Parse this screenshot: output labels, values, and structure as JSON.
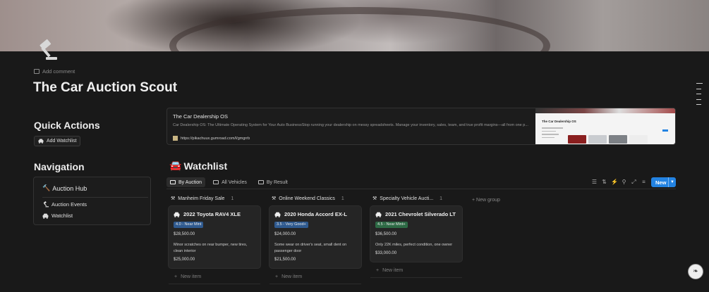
{
  "page": {
    "title": "The Car Auction Scout",
    "add_comment": "Add comment",
    "icon": "gavel-icon"
  },
  "quick_actions": {
    "heading": "Quick Actions",
    "add_watchlist": "Add Watchlist"
  },
  "navigation": {
    "heading": "Navigation",
    "hub_emoji": "🔨",
    "hub": "Auction Hub",
    "items": [
      {
        "label": "Auction Events",
        "icon": "gavel-icon"
      },
      {
        "label": "Watchlist",
        "icon": "car-icon"
      }
    ]
  },
  "bookmark": {
    "title": "The Car Dealership OS",
    "description": "Car Dealership OS: The Ultimate Operating System for Your Auto BusinessStop running your dealership on messy spreadsheets. Manage your inventory, sales, team, and true profit margins—all from one p...",
    "url": "https://pikachuux.gumroad.com/l/gmgrrb",
    "thumb_title": "The Car Dealership OS"
  },
  "watchlist": {
    "emoji": "🚘",
    "heading": "Watchlist",
    "tabs": [
      "By Auction",
      "All Vehicles",
      "By Result"
    ],
    "new_button": "New",
    "new_group": "+ New group",
    "new_item": "New item",
    "groups": [
      {
        "name": "Manheim Friday Sale",
        "count": "1",
        "card": {
          "title": "2022 Toyota RAV4 XLE",
          "badge": "4.0 - Near Mint",
          "badge_color": "#2f5a8f",
          "price": "$28,500.00",
          "note": "Minor scratches on rear bumper, new tires, clean interior",
          "estimate": "$25,000.00"
        }
      },
      {
        "name": "Online Weekend Classics",
        "count": "1",
        "card": {
          "title": "2020 Honda Accord EX-L",
          "badge": "3.5 - Very Good+",
          "badge_color": "#2f5a8f",
          "price": "$24,000.00",
          "note": "Some wear on driver's seat, small dent on passenger door",
          "estimate": "$21,500.00"
        }
      },
      {
        "name": "Specialty Vehicle Aucti...",
        "count": "1",
        "card": {
          "title": "2021 Chevrolet Silverado LT",
          "badge": "4.5 - Near Mint+",
          "badge_color": "#2d6a45",
          "price": "$36,500.00",
          "note": "Only 22K miles, perfect condition, one owner",
          "estimate": "$33,000.00"
        }
      }
    ]
  },
  "colors": {
    "background": "#191919",
    "accent": "#2383e2"
  }
}
